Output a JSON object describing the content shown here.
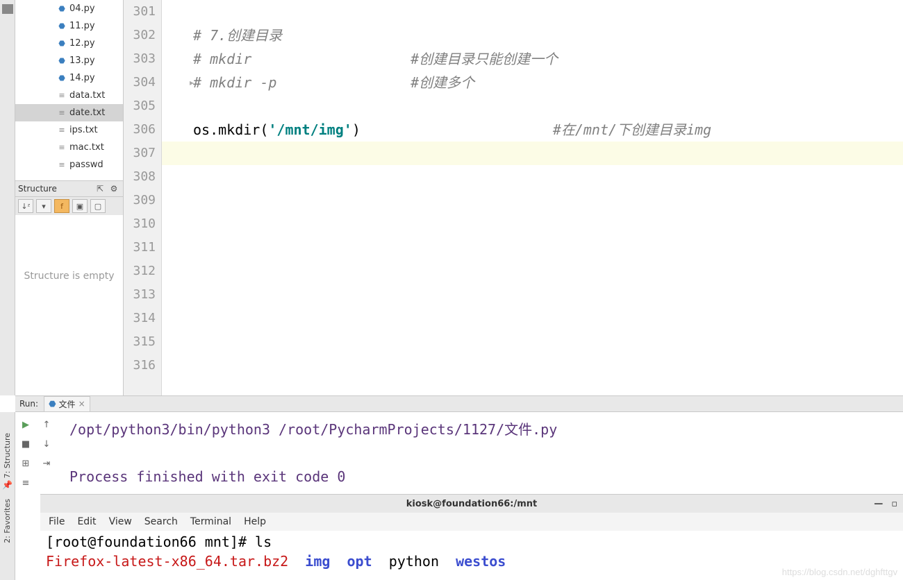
{
  "project": {
    "files": [
      {
        "name": "04.py",
        "type": "py",
        "selected": false
      },
      {
        "name": "11.py",
        "type": "py",
        "selected": false
      },
      {
        "name": "12.py",
        "type": "py",
        "selected": false
      },
      {
        "name": "13.py",
        "type": "py",
        "selected": false
      },
      {
        "name": "14.py",
        "type": "py",
        "selected": false
      },
      {
        "name": "data.txt",
        "type": "txt",
        "selected": false
      },
      {
        "name": "date.txt",
        "type": "txt",
        "selected": true
      },
      {
        "name": "ips.txt",
        "type": "txt",
        "selected": false
      },
      {
        "name": "mac.txt",
        "type": "txt",
        "selected": false
      },
      {
        "name": "passwd",
        "type": "txt",
        "selected": false
      }
    ]
  },
  "structure": {
    "title": "Structure",
    "empty_text": "Structure is empty"
  },
  "editor": {
    "first_line_no": 301,
    "lines": [
      {
        "segments": [
          {
            "text": "",
            "cls": ""
          }
        ]
      },
      {
        "segments": [
          {
            "text": "# 7.创建目录",
            "cls": "c-comment"
          }
        ]
      },
      {
        "segments": [
          {
            "text": "# mkdir                   ",
            "cls": "c-comment"
          },
          {
            "text": "#创建目录只能创建一个",
            "cls": "c-comment"
          }
        ]
      },
      {
        "segments": [
          {
            "text": "# mkdir -p                ",
            "cls": "c-comment"
          },
          {
            "text": "#创建多个",
            "cls": "c-comment"
          }
        ]
      },
      {
        "segments": [
          {
            "text": "",
            "cls": ""
          }
        ]
      },
      {
        "segments": [
          {
            "text": "os",
            "cls": "c-ident"
          },
          {
            "text": ".mkdir(",
            "cls": "c-paren"
          },
          {
            "text": "'/mnt/img'",
            "cls": "c-string"
          },
          {
            "text": ")",
            "cls": "c-paren"
          },
          {
            "text": "                       ",
            "cls": ""
          },
          {
            "text": "#在/mnt/下创建目录img",
            "cls": "c-comment"
          }
        ]
      },
      {
        "segments": [
          {
            "text": "",
            "cls": ""
          }
        ],
        "highlight": true
      },
      {
        "segments": [
          {
            "text": "",
            "cls": ""
          }
        ]
      },
      {
        "segments": [
          {
            "text": "",
            "cls": ""
          }
        ]
      },
      {
        "segments": [
          {
            "text": "",
            "cls": ""
          }
        ]
      },
      {
        "segments": [
          {
            "text": "",
            "cls": ""
          }
        ]
      },
      {
        "segments": [
          {
            "text": "",
            "cls": ""
          }
        ]
      },
      {
        "segments": [
          {
            "text": "",
            "cls": ""
          }
        ]
      },
      {
        "segments": [
          {
            "text": "",
            "cls": ""
          }
        ]
      },
      {
        "segments": [
          {
            "text": "",
            "cls": ""
          }
        ]
      },
      {
        "segments": [
          {
            "text": "",
            "cls": ""
          }
        ]
      }
    ]
  },
  "run": {
    "label": "Run:",
    "tab_name": "文件",
    "output": [
      "/opt/python3/bin/python3 /root/PycharmProjects/1127/文件.py",
      "",
      "Process finished with exit code 0"
    ]
  },
  "terminal": {
    "title": "kiosk@foundation66:/mnt",
    "menu": [
      "File",
      "Edit",
      "View",
      "Search",
      "Terminal",
      "Help"
    ],
    "lines": [
      {
        "segments": [
          {
            "text": "[root@foundation66 mnt]# ",
            "cls": "t-black"
          },
          {
            "text": "ls",
            "cls": "t-black"
          }
        ]
      },
      {
        "segments": [
          {
            "text": "Firefox-latest-x86_64.tar.bz2",
            "cls": "t-red"
          },
          {
            "text": "  ",
            "cls": ""
          },
          {
            "text": "img",
            "cls": "t-blue"
          },
          {
            "text": "  ",
            "cls": ""
          },
          {
            "text": "opt",
            "cls": "t-blue"
          },
          {
            "text": "  ",
            "cls": ""
          },
          {
            "text": "python",
            "cls": "t-black"
          },
          {
            "text": "  ",
            "cls": ""
          },
          {
            "text": "westos",
            "cls": "t-blue"
          }
        ]
      }
    ]
  },
  "left_tabs": {
    "structure": "7: Structure",
    "favorites": "2: Favorites"
  },
  "watermark": "https://blog.csdn.net/dghfttgv"
}
